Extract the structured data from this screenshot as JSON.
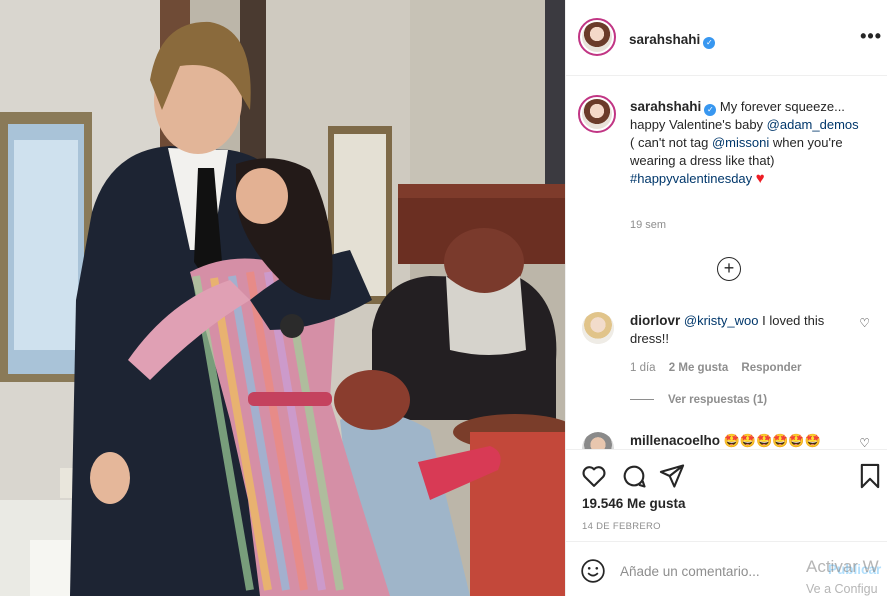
{
  "post": {
    "username": "sarahshahi",
    "verified_mark": "✓",
    "more_label": "•••",
    "caption_intro": "My forever squeeze... happy Valentine's baby ",
    "mention_1": "@adam_demos",
    "caption_mid": " ( can't not tag ",
    "mention_2": "@missoni",
    "caption_end": " when you're wearing a dress like that) ",
    "hashtag": "#happyvalentinesday",
    "heart": "♥",
    "time": "19 sem",
    "load_more": "+"
  },
  "comments": [
    {
      "username": "diorlovr",
      "mention": "@kristy_woo",
      "text": " I loved this dress!!",
      "age": "1 día",
      "likes": "2 Me gusta",
      "reply": "Responder",
      "view_replies": "Ver respuestas (1)"
    },
    {
      "username": "millenacoelho",
      "text": "🤩🤩🤩🤩🤩🤩"
    }
  ],
  "actions": {
    "likes": "19.546 Me gusta",
    "date": "14 DE FEBRERO"
  },
  "add_comment": {
    "placeholder": "Añade un comentario...",
    "publish": "Publicar"
  },
  "os_watermark": {
    "line1": "Activar W",
    "line2": "Ve a Configu"
  },
  "icons": {
    "like": "heart-outline-icon",
    "comment": "speech-bubble-icon",
    "share": "paper-plane-icon",
    "save": "bookmark-icon",
    "emoji": "smiley-icon",
    "options": "ellipsis-icon"
  },
  "colors": {
    "link": "#00376b",
    "verified": "#3897f0",
    "muted": "#8e8e8e",
    "heart": "#ed1c24",
    "publish_disabled": "#b2dffc"
  }
}
